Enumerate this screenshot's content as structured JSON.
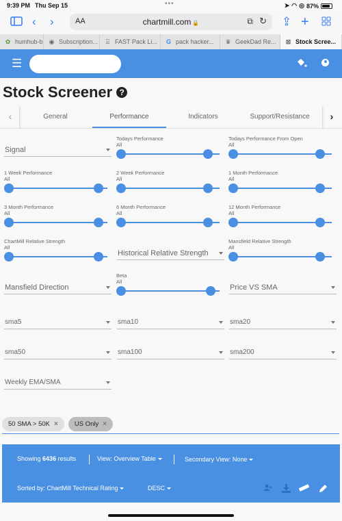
{
  "status_bar": {
    "time": "9:39 PM",
    "date": "Thu Sep 15",
    "battery": "87%",
    "battery_level": 0.87
  },
  "browser": {
    "address": "chartmill.com",
    "aa_label": "AA",
    "tabs": [
      {
        "label": "humhub-b",
        "icon": "humhub-icon"
      },
      {
        "label": "Subscription...",
        "icon": "compass-icon"
      },
      {
        "label": "FAST Pack Li...",
        "icon": "document-icon"
      },
      {
        "label": "pack hacker...",
        "icon": "google-icon"
      },
      {
        "label": "GeekDad Re...",
        "icon": "geekdad-icon"
      },
      {
        "label": "Stock Scree...",
        "icon": "close-icon",
        "active": true
      }
    ]
  },
  "app": {
    "search_placeholder": "",
    "title": "Stock Screener",
    "accent": "#4a90e2"
  },
  "filter_tabs": {
    "items": [
      "General",
      "Performance",
      "Indicators",
      "Support/Resistance"
    ],
    "active": "Performance"
  },
  "filters": {
    "signal": "Signal",
    "todays_perf": {
      "label": "Todays Performance",
      "value": "All"
    },
    "todays_perf_open": {
      "label": "Todays Performance From Open",
      "value": "All"
    },
    "week1": {
      "label": "1 Week Performance",
      "value": "All"
    },
    "week2": {
      "label": "2 Week Performance",
      "value": "All"
    },
    "month1": {
      "label": "1 Month Performance",
      "value": "All"
    },
    "month3": {
      "label": "3 Month Performance",
      "value": "All"
    },
    "month6": {
      "label": "6 Month Performance",
      "value": "All"
    },
    "month12": {
      "label": "12 Month Performance",
      "value": "All"
    },
    "cm_rs": {
      "label": "ChartMill Relative Strength",
      "value": "All"
    },
    "hist_rs": "Historical Relative Strength",
    "mansfield_rs": {
      "label": "Mansfield Relative Strength",
      "value": "All"
    },
    "mansfield_dir": "Mansfield Direction",
    "beta": {
      "label": "Beta",
      "value": "All"
    },
    "price_vs_sma": "Price VS SMA",
    "sma5": "sma5",
    "sma10": "sma10",
    "sma20": "sma20",
    "sma50": "sma50",
    "sma100": "sma100",
    "sma200": "sma200",
    "weekly_ema_sma": "Weekly EMA/SMA"
  },
  "chips": [
    {
      "label": "50 SMA > 50K"
    },
    {
      "label": "US Only"
    }
  ],
  "results": {
    "showing_prefix": "Showing",
    "count": "6436",
    "showing_suffix": "results",
    "view": "View: Overview Table",
    "secondary_view": "Secondary View: None",
    "sorted_by": "Sorted by: ChartMill Technical Rating",
    "order": "DESC"
  }
}
